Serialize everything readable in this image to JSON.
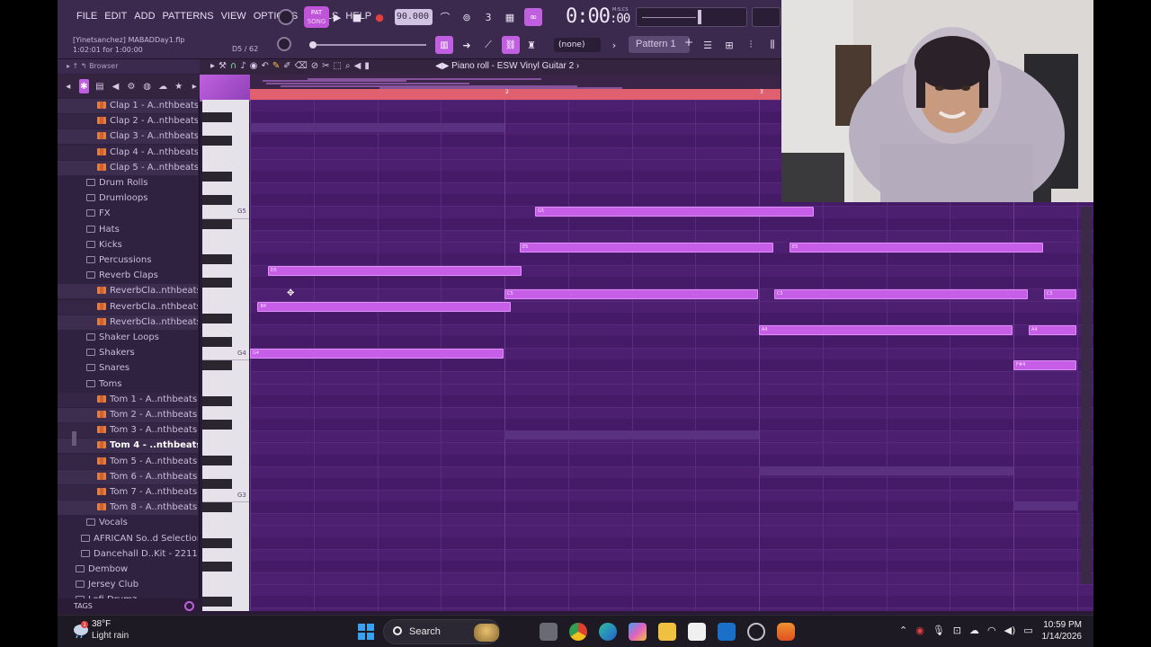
{
  "menu": [
    "FILE",
    "EDIT",
    "ADD",
    "PATTERNS",
    "VIEW",
    "OPTIONS",
    "TOOLS",
    "HELP"
  ],
  "transport": {
    "pat_label": "PAT",
    "song_label": "SONG",
    "tempo": "90.000",
    "time": "0:00",
    "time_small": ":00",
    "time_format": "M:S:CS"
  },
  "hint": {
    "project": "[Yinetsanchez] MABADDay1.flp",
    "length": "1:02:01 for 1:00:00",
    "note_pos": "D5 / 62"
  },
  "toolbar": {
    "snap_value": "(none)",
    "pattern": "Pattern 1",
    "pattern_add": "+"
  },
  "browser": {
    "title": "Browser",
    "tags_label": "TAGS",
    "items": [
      {
        "label": "Clap 1 - A..nthbeats",
        "type": "file",
        "indent": 2
      },
      {
        "label": "Clap 2 - A..nthbeats",
        "type": "file",
        "indent": 2
      },
      {
        "label": "Clap 3 - A..nthbeats",
        "type": "file",
        "indent": 2
      },
      {
        "label": "Clap 4 - A..nthbeats",
        "type": "file",
        "indent": 2
      },
      {
        "label": "Clap 5 - A..nthbeats",
        "type": "file",
        "indent": 2
      },
      {
        "label": "Drum Rolls",
        "type": "folder",
        "indent": 1
      },
      {
        "label": "Drumloops",
        "type": "folder",
        "indent": 1
      },
      {
        "label": "FX",
        "type": "folder",
        "indent": 1
      },
      {
        "label": "Hats",
        "type": "folder",
        "indent": 1
      },
      {
        "label": "Kicks",
        "type": "folder",
        "indent": 1
      },
      {
        "label": "Percussions",
        "type": "folder",
        "indent": 1
      },
      {
        "label": "Reverb Claps",
        "type": "folder",
        "indent": 1,
        "open": true
      },
      {
        "label": "ReverbCla..nthbeats",
        "type": "file",
        "indent": 2
      },
      {
        "label": "ReverbCla..nthbeats",
        "type": "file",
        "indent": 2
      },
      {
        "label": "ReverbCla..nthbeats",
        "type": "file",
        "indent": 2
      },
      {
        "label": "Shaker Loops",
        "type": "folder",
        "indent": 1
      },
      {
        "label": "Shakers",
        "type": "folder",
        "indent": 1
      },
      {
        "label": "Snares",
        "type": "folder",
        "indent": 1
      },
      {
        "label": "Toms",
        "type": "folder",
        "indent": 1,
        "open": true
      },
      {
        "label": "Tom 1 - A..nthbeats",
        "type": "file",
        "indent": 2
      },
      {
        "label": "Tom 2 - A..nthbeats",
        "type": "file",
        "indent": 2
      },
      {
        "label": "Tom 3 - A..nthbeats",
        "type": "file",
        "indent": 2
      },
      {
        "label": "Tom 4 - ..nthbeats",
        "type": "file",
        "indent": 2,
        "selected": true
      },
      {
        "label": "Tom 5 - A..nthbeats",
        "type": "file",
        "indent": 2
      },
      {
        "label": "Tom 6 - A..nthbeats",
        "type": "file",
        "indent": 2
      },
      {
        "label": "Tom 7 - A..nthbeats",
        "type": "file",
        "indent": 2
      },
      {
        "label": "Tom 8 - A..nthbeats",
        "type": "file",
        "indent": 2
      },
      {
        "label": "Vocals",
        "type": "folder",
        "indent": 1
      },
      {
        "label": "AFRICAN So..d Selection",
        "type": "folder",
        "indent": 0.5
      },
      {
        "label": "Dancehall D..Kit - 2211",
        "type": "folder",
        "indent": 0.5
      },
      {
        "label": "Dembow",
        "type": "folder",
        "indent": 0
      },
      {
        "label": "Jersey Club",
        "type": "folder",
        "indent": 0
      },
      {
        "label": "Lofi Drumz",
        "type": "folder",
        "indent": 0
      }
    ]
  },
  "piano_roll": {
    "title": "Piano roll - ESW Vinyl Guitar 2",
    "bar_labels": [
      "2",
      "3"
    ],
    "octave_labels": [
      "G5",
      "G4",
      "G3"
    ],
    "notes": [
      {
        "label": "G5",
        "start": 1.12,
        "length": 1.1,
        "pitch": 79
      },
      {
        "label": "E5",
        "start": 1.06,
        "length": 1.0,
        "pitch": 76
      },
      {
        "label": "E5",
        "start": 2.12,
        "length": 1.0,
        "pitch": 76
      },
      {
        "label": "D5",
        "start": 0.07,
        "length": 1.0,
        "pitch": 74
      },
      {
        "label": "C5",
        "start": 1.0,
        "length": 1.0,
        "pitch": 72
      },
      {
        "label": "C5",
        "start": 2.06,
        "length": 1.0,
        "pitch": 72
      },
      {
        "label": "C5",
        "start": 3.12,
        "length": 0.13,
        "pitch": 72
      },
      {
        "label": "B4",
        "start": 0.03,
        "length": 1.0,
        "pitch": 71
      },
      {
        "label": "A4",
        "start": 2.0,
        "length": 1.0,
        "pitch": 69
      },
      {
        "label": "A4",
        "start": 3.06,
        "length": 0.19,
        "pitch": 69
      },
      {
        "label": "F#4",
        "start": 3.0,
        "length": 0.25,
        "pitch": 66
      },
      {
        "label": "G4",
        "start": 0.0,
        "length": 1.0,
        "pitch": 67
      }
    ]
  },
  "taskbar": {
    "weather_temp": "38°F",
    "weather_desc": "Light rain",
    "weather_badge": "1",
    "search_label": "Search",
    "time": "10:59 PM",
    "date": "1/14/2026"
  }
}
